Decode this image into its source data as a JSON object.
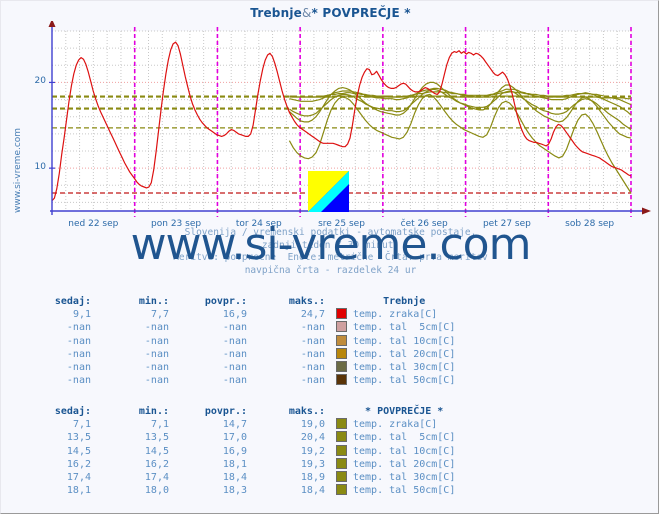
{
  "window": {
    "background": "#f7f8fd",
    "border_color": "#9a9a9a"
  },
  "header": {
    "title_station": "Trebnje",
    "title_separator": "&",
    "title_average": "* POVPREČJE *",
    "title_full": "Trebnje & * POVPREČJE *",
    "title_color": "#1a5592"
  },
  "side_watermark": "www.si-vreme.com",
  "watermark": "www.si-vreme.com",
  "logo": {
    "name": "si-vreme-logo",
    "color_top": "#ffff00",
    "color_mid": "#00ffff",
    "color_bottom": "#0000ff"
  },
  "caption": {
    "line1": "Slovenija / vremenski podatki - avtomatske postaje.",
    "line2": "zadnji teden / 30 minut.",
    "line3": "Meritve: povprečne  Enote: metrične  Črta: prva meritev",
    "line4": "navpična črta - razdelek 24 ur"
  },
  "chart_data": {
    "type": "line",
    "title": "Trebnje & * POVPREČJE *",
    "xlabel": "",
    "ylabel": "",
    "ylim": [
      5,
      26
    ],
    "yticks": [
      10,
      20
    ],
    "ytick_labels": [
      "10",
      "20"
    ],
    "grid": true,
    "legend_position": "below-table",
    "x_tick_labels": [
      "ned 22 sep",
      "pon 23 sep",
      "tor 24 sep",
      "sre 25 sep",
      "čet 26 sep",
      "pet 27 sep",
      "sob 28 sep"
    ],
    "day_separator_note": "navpična črta - razdelek 24 ur",
    "series": [
      {
        "name": "Trebnje temp. zraka[C]",
        "color": "#dd1111",
        "values": [
          6.2,
          6.5,
          7.6,
          9.4,
          11.6,
          13.5,
          15.6,
          17.8,
          19.6,
          21.0,
          22.0,
          22.6,
          22.9,
          22.7,
          22.1,
          21.2,
          20.1,
          19.0,
          18.1,
          17.3,
          16.6,
          16.0,
          15.4,
          14.8,
          14.2,
          13.6,
          13.0,
          12.4,
          11.8,
          11.2,
          10.6,
          10.1,
          9.6,
          9.2,
          8.8,
          8.4,
          8.1,
          7.9,
          7.8,
          7.7,
          7.8,
          8.3,
          9.8,
          12.0,
          14.4,
          16.8,
          19.0,
          21.0,
          22.6,
          23.8,
          24.5,
          24.7,
          24.3,
          23.3,
          22.0,
          20.7,
          19.5,
          18.4,
          17.5,
          16.8,
          16.2,
          15.7,
          15.3,
          15.0,
          14.7,
          14.5,
          14.3,
          14.1,
          13.9,
          13.8,
          13.7,
          13.8,
          14.0,
          14.3,
          14.5,
          14.4,
          14.2,
          14.0,
          13.9,
          13.8,
          13.7,
          13.7,
          14.0,
          15.0,
          16.8,
          18.6,
          20.2,
          21.6,
          22.6,
          23.2,
          23.4,
          23.0,
          22.2,
          21.2,
          20.1,
          19.0,
          18.0,
          17.2,
          16.5,
          16.0,
          15.5,
          15.1,
          14.8,
          14.6,
          14.4,
          14.2,
          14.0,
          13.8,
          13.6,
          13.4,
          13.2,
          13.0,
          12.9,
          12.9,
          12.9,
          12.9,
          12.9,
          12.8,
          12.7,
          12.6,
          12.5,
          12.5,
          12.8,
          13.5,
          15.0,
          16.8,
          18.4,
          19.7,
          20.6,
          21.2,
          21.6,
          21.5,
          20.9,
          21.0,
          21.3,
          20.8,
          20.3,
          19.9,
          19.6,
          19.4,
          19.3,
          19.3,
          19.4,
          19.6,
          19.8,
          19.9,
          19.8,
          19.5,
          19.2,
          19.0,
          18.9,
          18.9,
          19.0,
          19.2,
          19.4,
          19.3,
          19.1,
          18.9,
          18.7,
          18.6,
          18.9,
          19.8,
          21.0,
          22.1,
          22.9,
          23.4,
          23.6,
          23.5,
          23.7,
          23.4,
          23.6,
          23.3,
          23.5,
          23.4,
          23.2,
          23.4,
          23.3,
          23.1,
          22.8,
          22.4,
          22.0,
          21.6,
          21.2,
          20.9,
          20.8,
          21.0,
          21.2,
          20.9,
          20.4,
          19.6,
          18.6,
          17.4,
          16.2,
          15.2,
          14.4,
          13.8,
          13.4,
          13.2,
          13.1,
          13.0,
          13.0,
          12.9,
          12.8,
          12.7,
          12.6,
          12.8,
          13.4,
          14.2,
          14.8,
          15.1,
          15.0,
          14.7,
          14.3,
          13.9,
          13.5,
          13.1,
          12.7,
          12.4,
          12.1,
          11.9,
          11.8,
          11.7,
          11.6,
          11.5,
          11.4,
          11.3,
          11.2,
          11.0,
          10.8,
          10.6,
          10.4,
          10.2,
          10.1,
          10.0,
          9.9,
          9.8,
          9.6,
          9.4,
          9.2,
          9.1
        ]
      },
      {
        "name": "POVPREČJE temp. zraka[C]",
        "color": "#8a8a12",
        "start_fraction": 0.41,
        "values": [
          13.2,
          12.4,
          11.8,
          11.4,
          11.2,
          11.1,
          11.3,
          11.8,
          12.8,
          14.2,
          15.6,
          16.8,
          17.6,
          18.1,
          18.3,
          18.2,
          17.9,
          17.4,
          16.8,
          16.2,
          15.6,
          15.1,
          14.7,
          14.4,
          14.2,
          14.0,
          13.8,
          13.6,
          13.5,
          13.4,
          13.6,
          14.2,
          15.2,
          16.4,
          17.4,
          18.1,
          18.5,
          18.6,
          18.3,
          17.8,
          17.2,
          16.6,
          16.0,
          15.5,
          15.1,
          14.8,
          14.5,
          14.3,
          14.1,
          13.9,
          13.7,
          13.6,
          13.9,
          14.8,
          16.0,
          17.0,
          17.6,
          17.8,
          17.6,
          17.1,
          16.4,
          15.6,
          14.8,
          14.1,
          13.5,
          13.0,
          12.6,
          12.3,
          12.0,
          11.7,
          11.4,
          11.2,
          11.4,
          12.2,
          13.4,
          14.6,
          15.6,
          16.2,
          16.3,
          15.9,
          15.2,
          14.3,
          13.3,
          12.3,
          11.4,
          10.6,
          9.9,
          9.2,
          8.5,
          7.8,
          7.1
        ]
      },
      {
        "name": "POVPREČJE temp. tal 5cm[C]",
        "color": "#8a8a12",
        "start_fraction": 0.41,
        "values": [
          16.6,
          16.2,
          15.8,
          15.5,
          15.4,
          15.4,
          15.6,
          16.0,
          16.6,
          17.3,
          18.0,
          18.6,
          19.0,
          19.3,
          19.4,
          19.3,
          19.1,
          18.8,
          18.4,
          18.0,
          17.6,
          17.3,
          17.0,
          16.8,
          16.6,
          16.5,
          16.4,
          16.3,
          16.2,
          16.2,
          16.4,
          16.8,
          17.4,
          18.1,
          18.8,
          19.4,
          19.8,
          20.0,
          20.0,
          19.8,
          19.4,
          19.0,
          18.6,
          18.2,
          17.9,
          17.6,
          17.4,
          17.2,
          17.0,
          16.9,
          16.8,
          16.8,
          17.0,
          17.5,
          18.2,
          18.9,
          19.4,
          19.7,
          19.7,
          19.4,
          19.0,
          18.5,
          18.0,
          17.5,
          17.1,
          16.7,
          16.4,
          16.1,
          15.9,
          15.7,
          15.5,
          15.4,
          15.5,
          15.9,
          16.5,
          17.2,
          17.8,
          18.2,
          18.3,
          18.1,
          17.7,
          17.2,
          16.6,
          16.0,
          15.4,
          14.9,
          14.4,
          14.0,
          13.8,
          13.6,
          13.5
        ]
      },
      {
        "name": "POVPREČJE temp. tal 10cm[C]",
        "color": "#8a8a12",
        "start_fraction": 0.41,
        "values": [
          16.9,
          16.6,
          16.4,
          16.2,
          16.1,
          16.1,
          16.2,
          16.4,
          16.8,
          17.2,
          17.6,
          18.0,
          18.3,
          18.5,
          18.6,
          18.6,
          18.5,
          18.3,
          18.0,
          17.8,
          17.5,
          17.3,
          17.1,
          17.0,
          16.9,
          16.8,
          16.7,
          16.7,
          16.6,
          16.6,
          16.7,
          17.0,
          17.4,
          17.8,
          18.2,
          18.6,
          18.9,
          19.1,
          19.2,
          19.1,
          18.9,
          18.6,
          18.3,
          18.1,
          17.8,
          17.6,
          17.5,
          17.3,
          17.2,
          17.1,
          17.1,
          17.1,
          17.2,
          17.5,
          17.9,
          18.3,
          18.7,
          18.9,
          19.0,
          18.9,
          18.6,
          18.3,
          18.0,
          17.7,
          17.4,
          17.2,
          16.9,
          16.7,
          16.6,
          16.4,
          16.3,
          16.3,
          16.4,
          16.6,
          17.0,
          17.4,
          17.7,
          18.0,
          18.1,
          18.0,
          17.8,
          17.5,
          17.1,
          16.8,
          16.4,
          16.1,
          15.8,
          15.5,
          15.1,
          14.8,
          14.5
        ]
      },
      {
        "name": "POVPREČJE temp. tal 20cm[C]",
        "color": "#8a8a12",
        "start_fraction": 0.41,
        "values": [
          18.1,
          18.0,
          17.9,
          17.8,
          17.8,
          17.8,
          17.8,
          17.9,
          18.0,
          18.2,
          18.4,
          18.6,
          18.8,
          18.9,
          19.0,
          19.0,
          19.0,
          18.9,
          18.8,
          18.7,
          18.5,
          18.4,
          18.3,
          18.2,
          18.2,
          18.1,
          18.1,
          18.1,
          18.0,
          18.0,
          18.1,
          18.2,
          18.4,
          18.6,
          18.8,
          19.0,
          19.1,
          19.2,
          19.3,
          19.3,
          19.2,
          19.1,
          18.9,
          18.8,
          18.7,
          18.6,
          18.5,
          18.4,
          18.4,
          18.3,
          18.3,
          18.3,
          18.4,
          18.5,
          18.7,
          18.9,
          19.0,
          19.2,
          19.2,
          19.2,
          19.1,
          18.9,
          18.8,
          18.6,
          18.5,
          18.4,
          18.3,
          18.2,
          18.1,
          18.0,
          18.0,
          18.0,
          18.0,
          18.1,
          18.3,
          18.5,
          18.6,
          18.7,
          18.8,
          18.7,
          18.6,
          18.4,
          18.2,
          18.0,
          17.8,
          17.6,
          17.4,
          17.2,
          16.9,
          16.6,
          16.2
        ]
      },
      {
        "name": "POVPREČJE temp. tal 30cm[C]",
        "color": "#8a8a12",
        "start_fraction": 0.41,
        "values": [
          18.4,
          18.4,
          18.3,
          18.3,
          18.3,
          18.3,
          18.3,
          18.3,
          18.4,
          18.4,
          18.5,
          18.6,
          18.6,
          18.7,
          18.7,
          18.8,
          18.8,
          18.7,
          18.7,
          18.6,
          18.6,
          18.5,
          18.5,
          18.4,
          18.4,
          18.4,
          18.4,
          18.3,
          18.3,
          18.3,
          18.4,
          18.4,
          18.5,
          18.6,
          18.7,
          18.7,
          18.8,
          18.9,
          18.9,
          18.9,
          18.9,
          18.8,
          18.8,
          18.7,
          18.7,
          18.6,
          18.6,
          18.5,
          18.5,
          18.5,
          18.5,
          18.5,
          18.5,
          18.6,
          18.6,
          18.7,
          18.8,
          18.8,
          18.9,
          18.9,
          18.8,
          18.8,
          18.7,
          18.7,
          18.6,
          18.6,
          18.5,
          18.5,
          18.4,
          18.4,
          18.4,
          18.4,
          18.4,
          18.5,
          18.5,
          18.6,
          18.7,
          18.7,
          18.7,
          18.7,
          18.6,
          18.6,
          18.5,
          18.4,
          18.3,
          18.2,
          18.1,
          18.0,
          17.8,
          17.6,
          17.4
        ]
      },
      {
        "name": "POVPREČJE temp. tal 50cm[C]",
        "color": "#8a8a12",
        "start_fraction": 0.41,
        "values": [
          18.3,
          18.3,
          18.3,
          18.3,
          18.3,
          18.3,
          18.3,
          18.3,
          18.3,
          18.3,
          18.3,
          18.3,
          18.3,
          18.4,
          18.4,
          18.4,
          18.4,
          18.4,
          18.4,
          18.4,
          18.3,
          18.3,
          18.3,
          18.3,
          18.3,
          18.3,
          18.3,
          18.3,
          18.3,
          18.3,
          18.3,
          18.3,
          18.3,
          18.3,
          18.4,
          18.4,
          18.4,
          18.4,
          18.4,
          18.4,
          18.4,
          18.4,
          18.4,
          18.4,
          18.3,
          18.3,
          18.3,
          18.3,
          18.3,
          18.3,
          18.3,
          18.3,
          18.3,
          18.3,
          18.4,
          18.4,
          18.4,
          18.4,
          18.4,
          18.4,
          18.4,
          18.4,
          18.4,
          18.3,
          18.3,
          18.3,
          18.3,
          18.3,
          18.3,
          18.3,
          18.3,
          18.3,
          18.3,
          18.3,
          18.3,
          18.3,
          18.3,
          18.3,
          18.3,
          18.3,
          18.3,
          18.3,
          18.2,
          18.2,
          18.2,
          18.2,
          18.2,
          18.2,
          18.2,
          18.1,
          18.1
        ]
      }
    ],
    "reference_lines": [
      {
        "value": 18.4,
        "color": "#8a8a12",
        "style": "dashed"
      },
      {
        "value": 18.3,
        "color": "#8a8a12",
        "style": "dashed"
      },
      {
        "value": 17.0,
        "color": "#8a8a12",
        "style": "dashed"
      },
      {
        "value": 16.9,
        "color": "#8a8a12",
        "style": "dashed"
      },
      {
        "value": 14.7,
        "color": "#8a8a12",
        "style": "dashed"
      },
      {
        "value": 7.1,
        "color": "#c01818",
        "style": "dashed"
      }
    ]
  },
  "tables": [
    {
      "name": "trebnje-table",
      "headers": [
        "sedaj:",
        "min.:",
        "povpr.:",
        "maks.:"
      ],
      "station": "Trebnje",
      "rows": [
        {
          "sedaj": "9,1",
          "min": "7,7",
          "povpr": "16,9",
          "maks": "24,7",
          "color": "#e00000",
          "label": "temp. zraka[C]"
        },
        {
          "sedaj": "-nan",
          "min": "-nan",
          "povpr": "-nan",
          "maks": "-nan",
          "color": "#cfa0a0",
          "label": "temp. tal  5cm[C]"
        },
        {
          "sedaj": "-nan",
          "min": "-nan",
          "povpr": "-nan",
          "maks": "-nan",
          "color": "#c08c3c",
          "label": "temp. tal 10cm[C]"
        },
        {
          "sedaj": "-nan",
          "min": "-nan",
          "povpr": "-nan",
          "maks": "-nan",
          "color": "#b8860b",
          "label": "temp. tal 20cm[C]"
        },
        {
          "sedaj": "-nan",
          "min": "-nan",
          "povpr": "-nan",
          "maks": "-nan",
          "color": "#6b6b45",
          "label": "temp. tal 30cm[C]"
        },
        {
          "sedaj": "-nan",
          "min": "-nan",
          "povpr": "-nan",
          "maks": "-nan",
          "color": "#5a3408",
          "label": "temp. tal 50cm[C]"
        }
      ]
    },
    {
      "name": "povprecje-table",
      "headers": [
        "sedaj:",
        "min.:",
        "povpr.:",
        "maks.:"
      ],
      "station": "* POVPREČJE *",
      "rows": [
        {
          "sedaj": "7,1",
          "min": "7,1",
          "povpr": "14,7",
          "maks": "19,0",
          "color": "#8a8a12",
          "label": "temp. zraka[C]"
        },
        {
          "sedaj": "13,5",
          "min": "13,5",
          "povpr": "17,0",
          "maks": "20,4",
          "color": "#8a8a12",
          "label": "temp. tal  5cm[C]"
        },
        {
          "sedaj": "14,5",
          "min": "14,5",
          "povpr": "16,9",
          "maks": "19,2",
          "color": "#8a8a12",
          "label": "temp. tal 10cm[C]"
        },
        {
          "sedaj": "16,2",
          "min": "16,2",
          "povpr": "18,1",
          "maks": "19,3",
          "color": "#8a8a12",
          "label": "temp. tal 20cm[C]"
        },
        {
          "sedaj": "17,4",
          "min": "17,4",
          "povpr": "18,4",
          "maks": "18,9",
          "color": "#8a8a12",
          "label": "temp. tal 30cm[C]"
        },
        {
          "sedaj": "18,1",
          "min": "18,0",
          "povpr": "18,3",
          "maks": "18,4",
          "color": "#8a8a12",
          "label": "temp. tal 50cm[C]"
        }
      ]
    }
  ]
}
